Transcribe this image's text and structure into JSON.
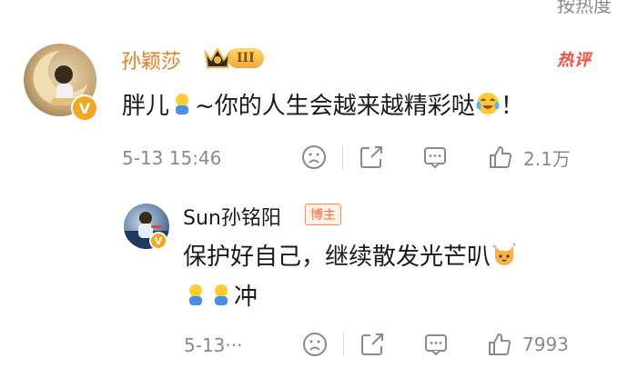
{
  "top_sort_label": "按热度",
  "main_comment": {
    "username": "孙颖莎",
    "level_badge": "III",
    "hot_label": "热评",
    "text_prefix": "胖儿",
    "text_middle": "~你的人生会越来越精彩哒",
    "text_suffix": "！",
    "timestamp": "5-13 15:46",
    "like_count": "2.1万"
  },
  "reply": {
    "username": "Sun孙铭阳",
    "role_tag": "博主",
    "text_line1": "保护好自己，继续散发光芒叭",
    "text_line2_suffix": "冲",
    "timestamp": "5-13···",
    "like_count": "7993"
  },
  "icons": {
    "dislike": "sad-face-icon",
    "share": "share-icon",
    "comment": "comment-icon",
    "like": "thumbs-up-icon"
  },
  "colors": {
    "username_highlight": "#f07a1e",
    "hot_badge": "#ff4b3b",
    "blogger_tag": "#ff6a2a",
    "verified_badge": "#f5a623",
    "secondary_text": "#8a8a8a"
  }
}
